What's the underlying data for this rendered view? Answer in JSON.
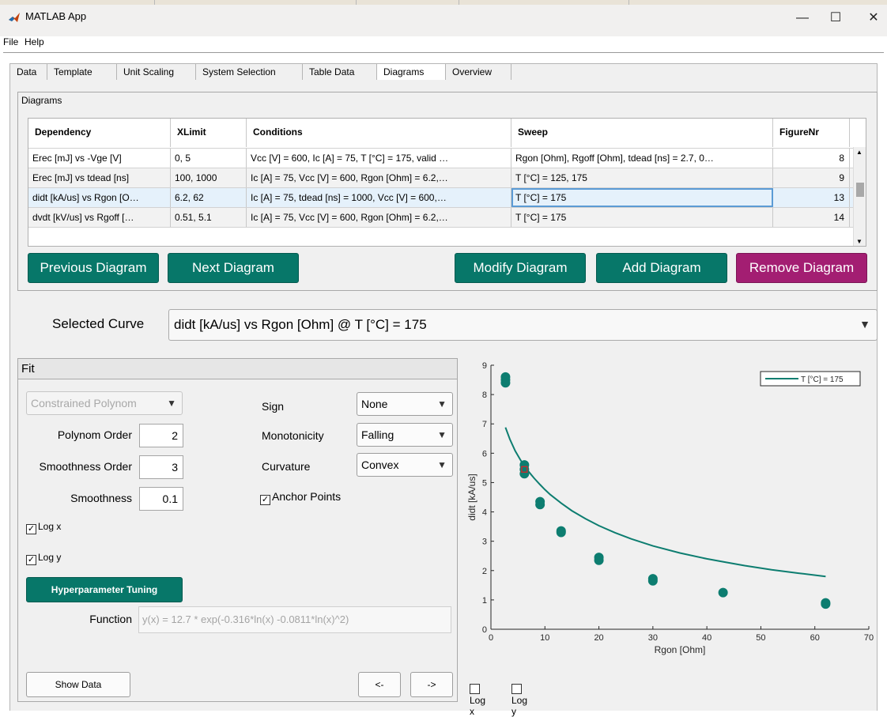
{
  "window": {
    "title": "MATLAB App",
    "minimize": "—",
    "maximize": "☐",
    "close": "✕"
  },
  "menu": {
    "file": "File",
    "help": "Help"
  },
  "tabs": [
    "Data",
    "Template",
    "Unit Scaling",
    "System Selection",
    "Table Data",
    "Diagrams",
    "Overview"
  ],
  "active_tab": "Diagrams",
  "diagrams_panel": {
    "title": "Diagrams",
    "columns": [
      "Dependency",
      "XLimit",
      "Conditions",
      "Sweep",
      "FigureNr"
    ],
    "rows": [
      {
        "dependency": "Erec [mJ] vs -Vge [V]",
        "xlimit": "0, 5",
        "conditions": "Vcc [V] = 600, Ic [A] = 75, T [°C] = 175, valid …",
        "sweep": "Rgon [Ohm], Rgoff [Ohm], tdead [ns] = 2.7, 0…",
        "figure": "8"
      },
      {
        "dependency": "Erec [mJ] vs tdead [ns]",
        "xlimit": "100, 1000",
        "conditions": "Ic [A] = 75, Vcc [V] = 600, Rgon [Ohm] = 6.2,…",
        "sweep": "T [°C] = 125, 175",
        "figure": "9"
      },
      {
        "dependency": "didt [kA/us] vs Rgon [O…",
        "xlimit": "6.2, 62",
        "conditions": "Ic [A] = 75, tdead [ns] = 1000, Vcc [V] = 600,…",
        "sweep": "T [°C] = 175",
        "figure": "13"
      },
      {
        "dependency": "dvdt [kV/us] vs Rgoff […",
        "xlimit": "0.51, 5.1",
        "conditions": "Ic [A] = 75, Vcc [V] = 600, Rgon [Ohm] = 6.2,…",
        "sweep": "T [°C] = 175",
        "figure": "14"
      }
    ],
    "buttons": {
      "previous": "Previous Diagram",
      "next": "Next Diagram",
      "modify": "Modify Diagram",
      "add": "Add Diagram",
      "remove": "Remove Diagram"
    }
  },
  "selected_curve": {
    "label": "Selected Curve",
    "value": "didt [kA/us] vs Rgon [Ohm] @ T [°C] = 175"
  },
  "fit": {
    "title": "Fit",
    "method": "Constrained Polynom",
    "polynom_order_label": "Polynom Order",
    "polynom_order": "2",
    "smoothness_order_label": "Smoothness Order",
    "smoothness_order": "3",
    "smoothness_label": "Smoothness",
    "smoothness": "0.1",
    "sign_label": "Sign",
    "sign": "None",
    "monotonicity_label": "Monotonicity",
    "monotonicity": "Falling",
    "curvature_label": "Curvature",
    "curvature": "Convex",
    "anchor_points_label": "Anchor Points",
    "log_x_label": "Log x",
    "log_y_label": "Log y",
    "hyper_button": "Hyperparameter Tuning",
    "function_label": "Function",
    "function_value": "y(x) = 12.7 * exp(-0.316*ln(x) -0.0811*ln(x)^2)",
    "show_data": "Show Data",
    "prev_arrow": "<-",
    "next_arrow": "->"
  },
  "plot_checks": {
    "log_x": "Log x",
    "log_y": "Log y"
  },
  "colors": {
    "accent": "#077769",
    "danger": "#a31e72",
    "series": "#0d7d70",
    "anchor": "#d62728"
  },
  "chart_data": {
    "type": "scatter",
    "title": "",
    "xlabel": "Rgon [Ohm]",
    "ylabel": "didt [kA/us]",
    "xlim": [
      0,
      70
    ],
    "ylim": [
      0,
      9
    ],
    "xticks": [
      0,
      10,
      20,
      30,
      40,
      50,
      60,
      70
    ],
    "yticks": [
      0,
      1,
      2,
      3,
      4,
      5,
      6,
      7,
      8,
      9
    ],
    "legend": {
      "position": "top-right",
      "entries": [
        "T [°C] = 175"
      ]
    },
    "points": [
      [
        2.7,
        8.6
      ],
      [
        2.7,
        8.5
      ],
      [
        2.7,
        8.4
      ],
      [
        6.2,
        5.6
      ],
      [
        6.2,
        5.45
      ],
      [
        6.2,
        5.3
      ],
      [
        9.1,
        4.35
      ],
      [
        9.1,
        4.25
      ],
      [
        13,
        3.35
      ],
      [
        13,
        3.3
      ],
      [
        20,
        2.45
      ],
      [
        20,
        2.35
      ],
      [
        30,
        1.72
      ],
      [
        30,
        1.65
      ],
      [
        43,
        1.25
      ],
      [
        62,
        0.9
      ],
      [
        62,
        0.86
      ]
    ],
    "fit_curve_x": [
      2.7,
      3.5,
      4.5,
      5.5,
      6.2,
      7,
      8,
      9.1,
      10,
      11,
      13,
      15,
      17.5,
      20,
      23,
      26,
      30,
      35,
      40,
      43,
      47,
      52,
      57,
      62
    ],
    "fit_curve_y": [
      6.88,
      6.48,
      6.08,
      5.76,
      5.57,
      5.37,
      5.15,
      4.93,
      4.76,
      4.59,
      4.3,
      4.04,
      3.77,
      3.53,
      3.29,
      3.08,
      2.84,
      2.6,
      2.4,
      2.3,
      2.17,
      2.03,
      1.91,
      1.8
    ],
    "anchor_point": [
      6.2,
      5.45
    ]
  }
}
